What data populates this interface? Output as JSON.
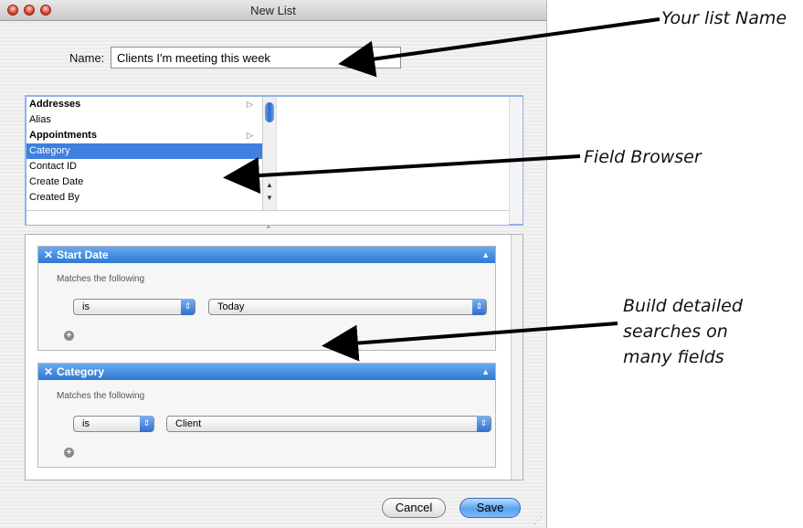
{
  "window": {
    "title": "New List"
  },
  "name_row": {
    "label": "Name:",
    "value": "Clients I'm meeting this week"
  },
  "field_browser": {
    "items": [
      {
        "label": "Addresses",
        "bold": true,
        "submenu": true
      },
      {
        "label": "Alias",
        "bold": false,
        "submenu": false
      },
      {
        "label": "Appointments",
        "bold": true,
        "submenu": true
      },
      {
        "label": "Category",
        "bold": false,
        "submenu": false,
        "selected": true
      },
      {
        "label": "Contact ID",
        "bold": false,
        "submenu": false
      },
      {
        "label": "Create Date",
        "bold": false,
        "submenu": false
      },
      {
        "label": "Created By",
        "bold": false,
        "submenu": false
      }
    ]
  },
  "criteria": [
    {
      "title": "Start Date",
      "match_text": "Matches the following",
      "operator": "is",
      "value": "Today"
    },
    {
      "title": "Category",
      "match_text": "Matches the following",
      "operator": "is",
      "value": "Client"
    }
  ],
  "buttons": {
    "cancel": "Cancel",
    "save": "Save"
  },
  "annotations": {
    "list_name": "Your list Name",
    "field_browser": "Field Browser",
    "build_line1": "Build detailed",
    "build_line2": "searches on",
    "build_line3": "many fields"
  },
  "colors": {
    "selection": "#3d80df",
    "header_blue": "#2d79d4"
  }
}
